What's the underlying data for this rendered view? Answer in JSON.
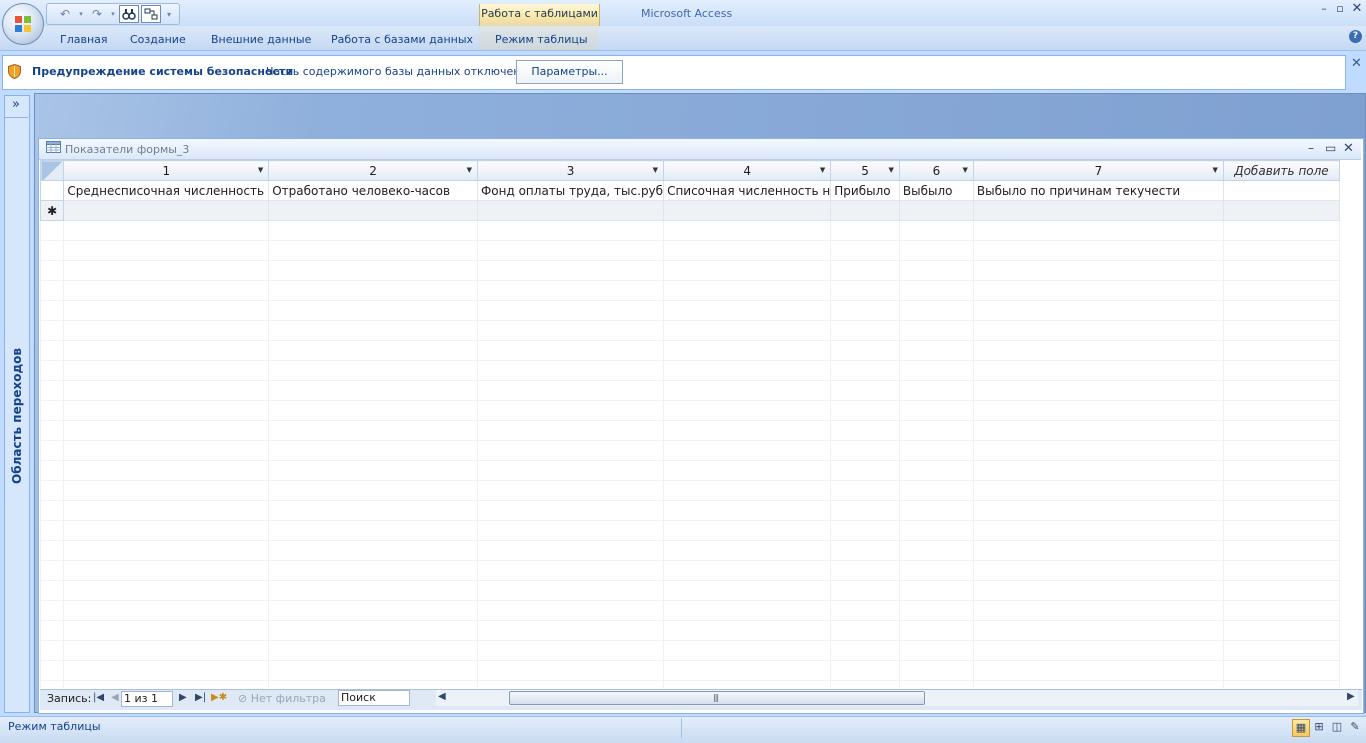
{
  "app": {
    "title": "Microsoft Access",
    "context_tab_group": "Работа с таблицами"
  },
  "ribbon": {
    "tabs": [
      "Главная",
      "Создание",
      "Внешние данные",
      "Работа с базами данных"
    ],
    "context_tab": "Режим таблицы",
    "help": "?"
  },
  "security_bar": {
    "title": "Предупреждение системы безопасности",
    "message": "Часть содержимого базы данных отключено",
    "params_button": "Параметры..."
  },
  "nav_pane": {
    "label": "Область переходов",
    "toggle": "»"
  },
  "document": {
    "title": "Показатели формы_3"
  },
  "grid": {
    "columns": [
      "1",
      "2",
      "3",
      "4",
      "5",
      "6",
      "7"
    ],
    "add_field": "Добавить поле",
    "captions": [
      "Среднесписочная численность",
      "Отработано человеко-часов",
      "Фонд оплаты труда, тыс.руб",
      "Списочная численность н",
      "Прибыло",
      "Выбыло",
      "Выбыло по причинам текучести"
    ],
    "new_row_marker": "✱"
  },
  "record_nav": {
    "label": "Запись:",
    "counter": "1 из 1",
    "filter": "Нет фильтра",
    "search": "Поиск"
  },
  "status": {
    "text": "Режим таблицы"
  }
}
